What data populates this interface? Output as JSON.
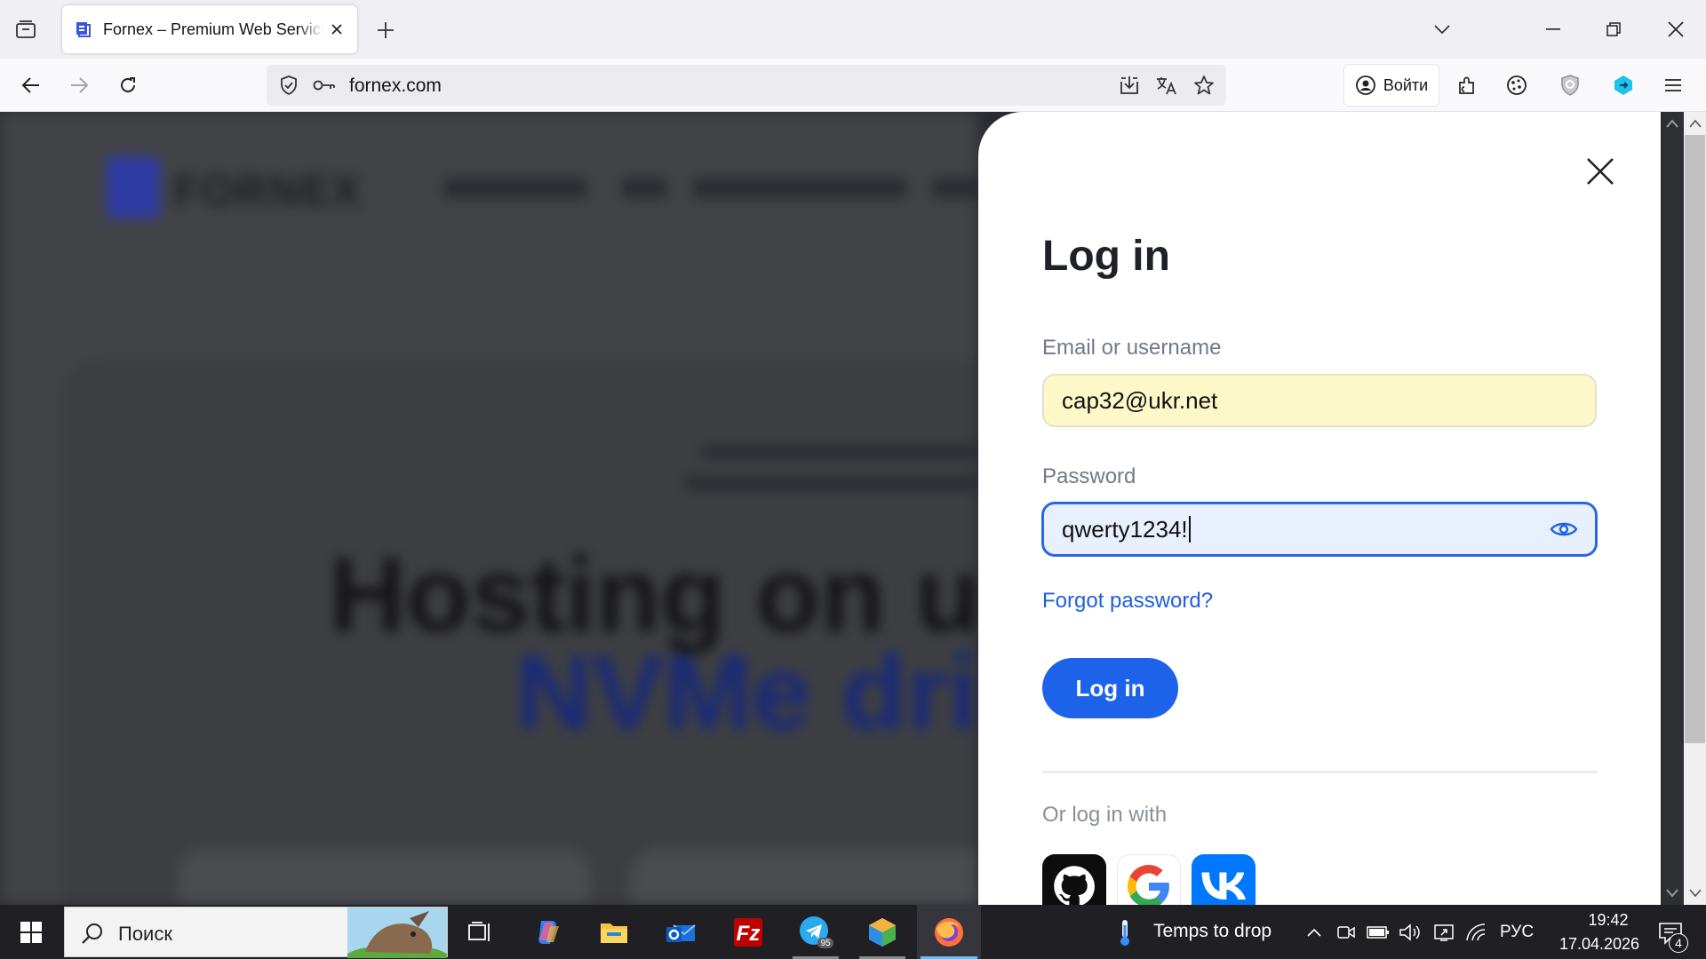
{
  "browser": {
    "tab_title": "Fornex – Premium Web Services",
    "url": "fornex.com",
    "account_button_label": "Войти"
  },
  "modal": {
    "title": "Log in",
    "email_label": "Email or username",
    "email_value": "cap32@ukr.net",
    "password_label": "Password",
    "password_value": "qwerty1234!",
    "forgot_link": "Forgot password?",
    "submit_label": "Log in",
    "social_prompt": "Or log in with",
    "social_providers": [
      "GitHub",
      "Google",
      "VK"
    ]
  },
  "background_page": {
    "hero_line1": "Hosting on ul",
    "hero_line2": "NVMe dri"
  },
  "taskbar": {
    "search_placeholder": "Поиск",
    "weather_text": "Temps to drop",
    "language": "РУС",
    "time": "19:42",
    "date": "17.04.2026",
    "notification_count": "4",
    "telegram_badge": "95"
  },
  "colors": {
    "primary_blue": "#1d63ea",
    "link_blue": "#1f5fe0",
    "autofill_yellow": "#fdf8c8",
    "focused_field": "#e8f0fe"
  }
}
